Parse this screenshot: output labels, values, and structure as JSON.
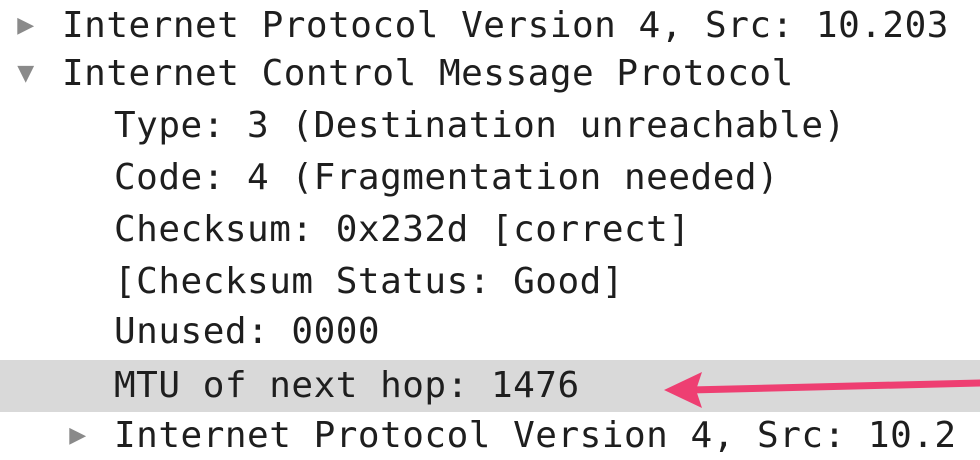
{
  "tree": {
    "rows": [
      {
        "text": "Internet Protocol Version 4, Src: 10.203",
        "toggle": "▶"
      },
      {
        "text": "Internet Control Message Protocol",
        "toggle": "▼"
      },
      {
        "text": "Type: 3 (Destination unreachable)"
      },
      {
        "text": "Code: 4 (Fragmentation needed)"
      },
      {
        "text": "Checksum: 0x232d [correct]"
      },
      {
        "text": "[Checksum Status: Good]"
      },
      {
        "text": "Unused: 0000"
      },
      {
        "text": "MTU of next hop: 1476"
      },
      {
        "text": "Internet Protocol Version 4, Src: 10.2",
        "toggle": "▶"
      }
    ]
  },
  "colors": {
    "selected_row": "#d9d9d9",
    "annotation_arrow": "#ee3f72"
  }
}
